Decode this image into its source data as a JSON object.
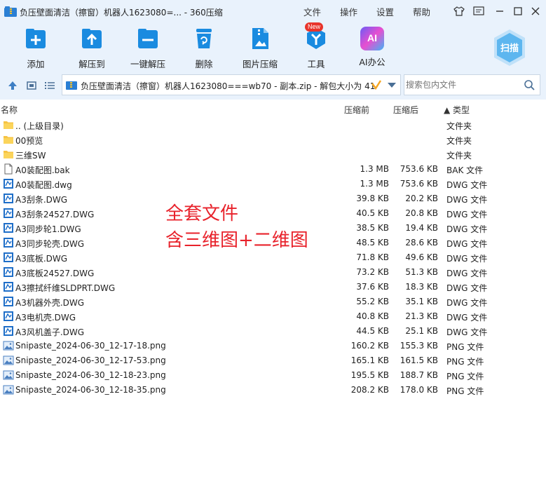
{
  "window": {
    "title": "负压壁面清洁（擦窗）机器人1623080=... - 360压缩",
    "menus": [
      "文件",
      "操作",
      "设置",
      "帮助"
    ]
  },
  "toolbar": {
    "items": [
      {
        "label": "添加",
        "icon": "add-icon"
      },
      {
        "label": "解压到",
        "icon": "extract-to-icon"
      },
      {
        "label": "一键解压",
        "icon": "one-click-extract-icon"
      },
      {
        "label": "删除",
        "icon": "delete-icon"
      },
      {
        "label": "图片压缩",
        "icon": "image-compress-icon"
      },
      {
        "label": "工具",
        "icon": "tools-icon",
        "badge": "New"
      },
      {
        "label": "AI办公",
        "icon": "ai-office-icon",
        "icon_text": "AI"
      }
    ],
    "scan_label": "扫描"
  },
  "address": {
    "path": "负压壁面清洁（擦窗）机器人1623080===wb70 - 副本.zip - 解包大小为 41",
    "search_placeholder": "搜索包内文件"
  },
  "columns": {
    "name": "名称",
    "before": "压缩前",
    "after": "压缩后",
    "type": "▲ 类型"
  },
  "files": [
    {
      "name": ".. (上级目录)",
      "before": "",
      "after": "",
      "type": "文件夹",
      "kind": "folder"
    },
    {
      "name": "00预览",
      "before": "",
      "after": "",
      "type": "文件夹",
      "kind": "folder"
    },
    {
      "name": "三维SW",
      "before": "",
      "after": "",
      "type": "文件夹",
      "kind": "folder"
    },
    {
      "name": "A0装配图.bak",
      "before": "1.3 MB",
      "after": "753.6 KB",
      "type": "BAK 文件",
      "kind": "bak"
    },
    {
      "name": "A0装配图.dwg",
      "before": "1.3 MB",
      "after": "753.6 KB",
      "type": "DWG 文件",
      "kind": "dwg"
    },
    {
      "name": "A3刮条.DWG",
      "before": "39.8 KB",
      "after": "20.2 KB",
      "type": "DWG 文件",
      "kind": "dwg"
    },
    {
      "name": "A3刮条24527.DWG",
      "before": "40.5 KB",
      "after": "20.8 KB",
      "type": "DWG 文件",
      "kind": "dwg"
    },
    {
      "name": "A3同步轮1.DWG",
      "before": "38.5 KB",
      "after": "19.4 KB",
      "type": "DWG 文件",
      "kind": "dwg"
    },
    {
      "name": "A3同步轮壳.DWG",
      "before": "48.5 KB",
      "after": "28.6 KB",
      "type": "DWG 文件",
      "kind": "dwg"
    },
    {
      "name": "A3底板.DWG",
      "before": "71.8 KB",
      "after": "49.6 KB",
      "type": "DWG 文件",
      "kind": "dwg"
    },
    {
      "name": "A3底板24527.DWG",
      "before": "73.2 KB",
      "after": "51.3 KB",
      "type": "DWG 文件",
      "kind": "dwg"
    },
    {
      "name": "A3擦拭纤维SLDPRT.DWG",
      "before": "37.6 KB",
      "after": "18.3 KB",
      "type": "DWG 文件",
      "kind": "dwg"
    },
    {
      "name": "A3机器外壳.DWG",
      "before": "55.2 KB",
      "after": "35.1 KB",
      "type": "DWG 文件",
      "kind": "dwg"
    },
    {
      "name": "A3电机壳.DWG",
      "before": "40.8 KB",
      "after": "21.3 KB",
      "type": "DWG 文件",
      "kind": "dwg"
    },
    {
      "name": "A3风机盖子.DWG",
      "before": "44.5 KB",
      "after": "25.1 KB",
      "type": "DWG 文件",
      "kind": "dwg"
    },
    {
      "name": "Snipaste_2024-06-30_12-17-18.png",
      "before": "160.2 KB",
      "after": "155.3 KB",
      "type": "PNG 文件",
      "kind": "png"
    },
    {
      "name": "Snipaste_2024-06-30_12-17-53.png",
      "before": "165.1 KB",
      "after": "161.5 KB",
      "type": "PNG 文件",
      "kind": "png"
    },
    {
      "name": "Snipaste_2024-06-30_12-18-23.png",
      "before": "195.5 KB",
      "after": "188.7 KB",
      "type": "PNG 文件",
      "kind": "png"
    },
    {
      "name": "Snipaste_2024-06-30_12-18-35.png",
      "before": "208.2 KB",
      "after": "178.0 KB",
      "type": "PNG 文件",
      "kind": "png"
    }
  ],
  "overlay": {
    "line1": "全套文件",
    "line2": "含三维图+二维图"
  },
  "colors": {
    "chrome": "#e9f2fc",
    "accent": "#1a8be0",
    "overlay_text": "#e8222b"
  }
}
